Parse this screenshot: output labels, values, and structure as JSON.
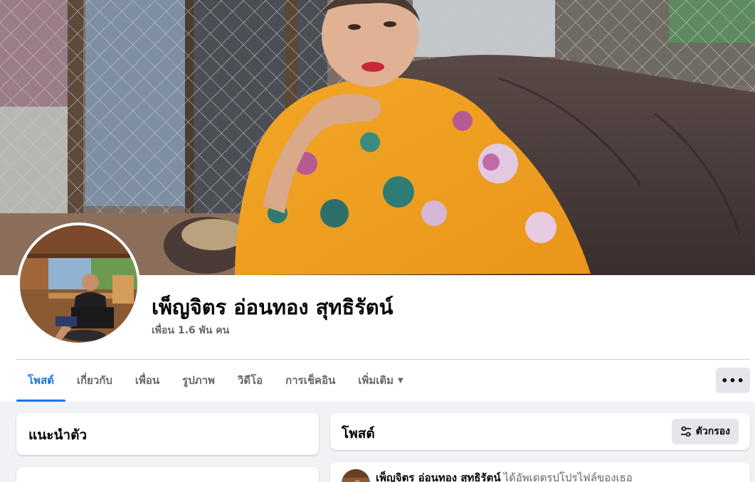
{
  "profile": {
    "name": "เพ็ญจิตร อ่อนทอง สุทธิรัตน์",
    "friends": "เพื่อน 1.6 พัน คน"
  },
  "tabs": [
    {
      "label": "โพสต์",
      "active": true
    },
    {
      "label": "เกี่ยวกับ",
      "active": false
    },
    {
      "label": "เพื่อน",
      "active": false
    },
    {
      "label": "รูปภาพ",
      "active": false
    },
    {
      "label": "วิดีโอ",
      "active": false
    },
    {
      "label": "การเช็คอิน",
      "active": false
    },
    {
      "label": "เพิ่มเติม",
      "active": false
    }
  ],
  "more_button": "•••",
  "intro": {
    "title": "แนะนำตัว"
  },
  "posts": {
    "title": "โพสต์",
    "filter_label": "ตัวกรอง"
  },
  "post": {
    "author": "เพ็ญจิตร อ่อนทอง สุทธิรัตน์",
    "action": "ได้อัพเดตรูปโปรไฟล์ของเธอ"
  },
  "colors": {
    "accent": "#1b74e4",
    "background": "#f0f2f5",
    "secondary_text": "#65676b",
    "button_gray": "#e4e6eb"
  },
  "icons": {
    "more": "more-dots-icon",
    "dropdown": "caret-down-icon",
    "filter": "sliders-icon"
  }
}
